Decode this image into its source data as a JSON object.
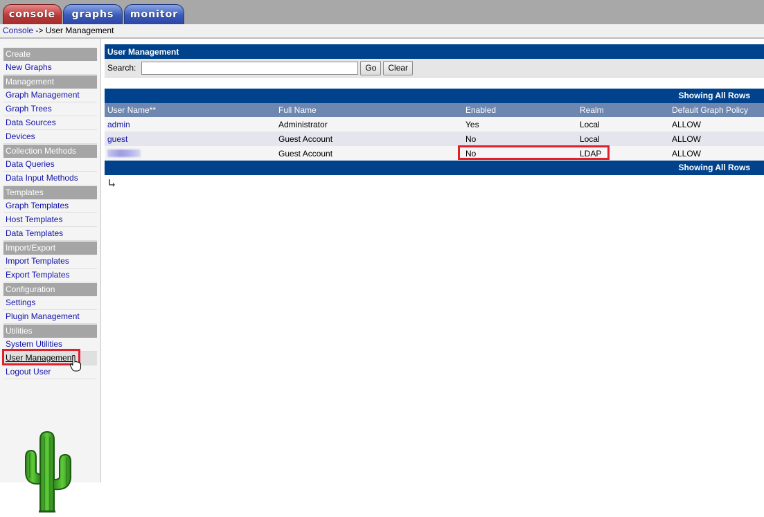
{
  "tabs": [
    {
      "label": "console",
      "active": true
    },
    {
      "label": "graphs",
      "active": false
    },
    {
      "label": "monitor",
      "active": false
    }
  ],
  "breadcrumb": {
    "root": "Console",
    "separator": " -> ",
    "current": "User Management"
  },
  "sidebar": {
    "sections": [
      {
        "header": "Create",
        "items": [
          "New Graphs"
        ]
      },
      {
        "header": "Management",
        "items": [
          "Graph Management",
          "Graph Trees",
          "Data Sources",
          "Devices"
        ]
      },
      {
        "header": "Collection Methods",
        "items": [
          "Data Queries",
          "Data Input Methods"
        ]
      },
      {
        "header": "Templates",
        "items": [
          "Graph Templates",
          "Host Templates",
          "Data Templates"
        ]
      },
      {
        "header": "Import/Export",
        "items": [
          "Import Templates",
          "Export Templates"
        ]
      },
      {
        "header": "Configuration",
        "items": [
          "Settings",
          "Plugin Management"
        ]
      },
      {
        "header": "Utilities",
        "items": [
          "System Utilities",
          "User Management",
          "Logout User"
        ]
      }
    ],
    "selected": "User Management"
  },
  "panel": {
    "title": "User Management",
    "search_label": "Search:",
    "search_value": "",
    "go_label": "Go",
    "clear_label": "Clear"
  },
  "grid": {
    "nav_text_top": "Showing All Rows",
    "nav_text_bottom": "Showing All Rows",
    "columns": [
      "User Name**",
      "Full Name",
      "Enabled",
      "Realm",
      "Default Graph Policy"
    ],
    "rows": [
      {
        "user": "admin",
        "full_name": "Administrator",
        "enabled": "Yes",
        "realm": "Local",
        "policy": "ALLOW"
      },
      {
        "user": "guest",
        "full_name": "Guest Account",
        "enabled": "No",
        "realm": "Local",
        "policy": "ALLOW"
      },
      {
        "user": "",
        "full_name": "Guest Account",
        "enabled": "No",
        "realm": "LDAP",
        "policy": "ALLOW"
      }
    ]
  },
  "colors": {
    "header_blue": "#00438c",
    "column_header": "#6d87b0",
    "highlight_red": "#e0202a",
    "link_blue": "#1111a8"
  },
  "icons": [
    "cactus-logo",
    "return-arrow-icon",
    "hand-cursor-icon"
  ]
}
